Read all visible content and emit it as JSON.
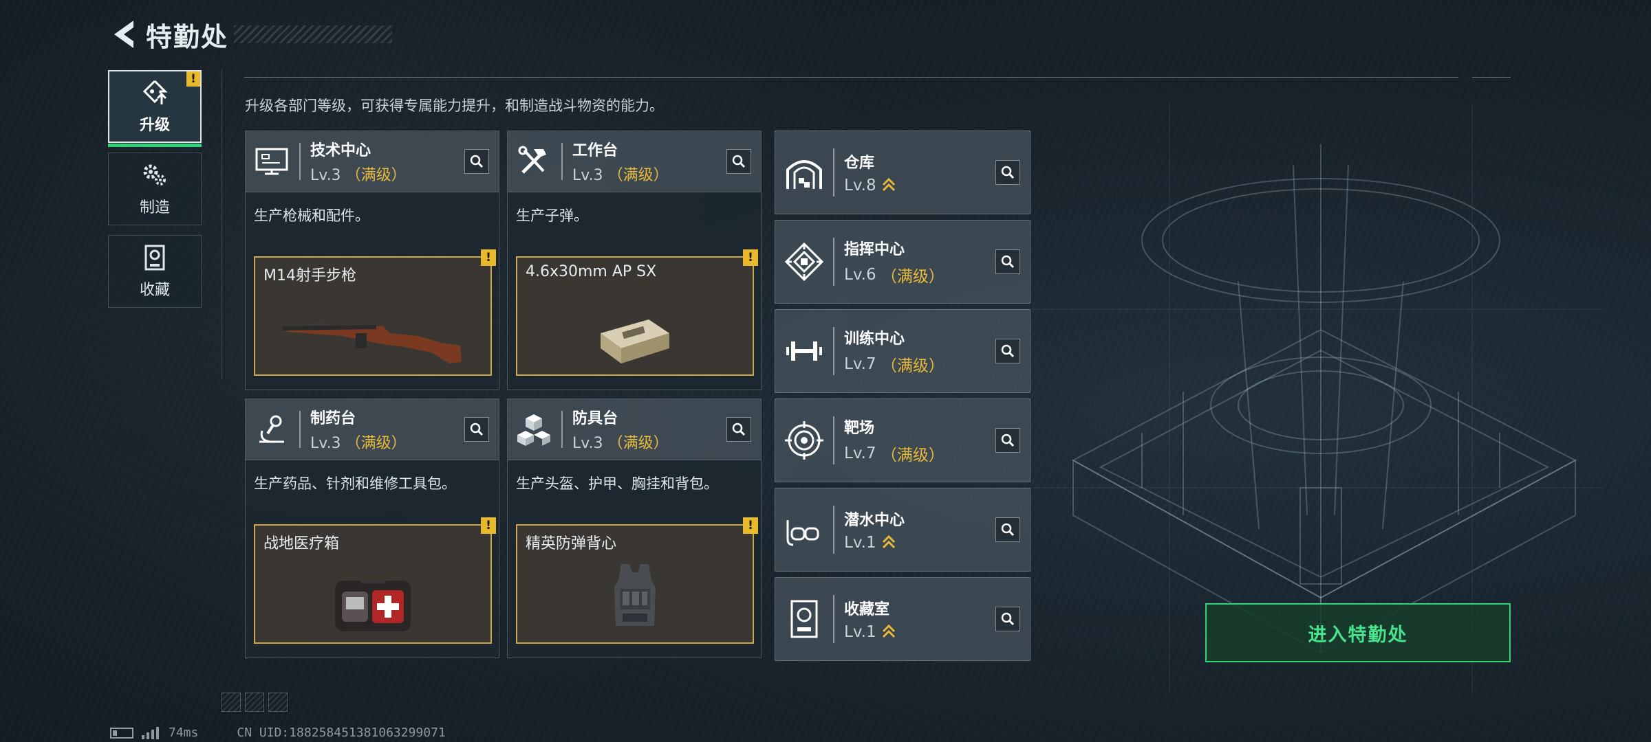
{
  "header": {
    "title": "特勤处"
  },
  "side_nav": [
    {
      "label": "升级",
      "active": true,
      "alert": "!",
      "icon": "upgrade-icon"
    },
    {
      "label": "制造",
      "active": false,
      "icon": "gears-icon"
    },
    {
      "label": "收藏",
      "active": false,
      "icon": "collection-icon"
    }
  ],
  "description": "升级各部门等级，可获得专属能力提升，和制造战斗物资的能力。",
  "stations": [
    {
      "name": "技术中心",
      "level": "Lv.3",
      "max": "（满级）",
      "desc": "生产枪械和配件。",
      "product": "M14射手步枪",
      "alert": "!",
      "icon": "computer-icon"
    },
    {
      "name": "工作台",
      "level": "Lv.3",
      "max": "（满级）",
      "desc": "生产子弹。",
      "product": "4.6x30mm AP SX",
      "alert": "!",
      "icon": "tools-icon"
    },
    {
      "name": "制药台",
      "level": "Lv.3",
      "max": "（满级）",
      "desc": "生产药品、针剂和维修工具包。",
      "product": "战地医疗箱",
      "alert": "!",
      "icon": "microscope-icon"
    },
    {
      "name": "防具台",
      "level": "Lv.3",
      "max": "（满级）",
      "desc": "生产头盔、护甲、胸挂和背包。",
      "product": "精英防弹背心",
      "alert": "!",
      "icon": "armor-blocks-icon"
    }
  ],
  "facilities": [
    {
      "name": "仓库",
      "level": "Lv.8",
      "max": "",
      "upgradable": true,
      "icon": "warehouse-icon"
    },
    {
      "name": "指挥中心",
      "level": "Lv.6",
      "max": "（满级）",
      "upgradable": false,
      "icon": "command-icon"
    },
    {
      "name": "训练中心",
      "level": "Lv.7",
      "max": "（满级）",
      "upgradable": false,
      "icon": "dumbbell-icon"
    },
    {
      "name": "靶场",
      "level": "Lv.7",
      "max": "（满级）",
      "upgradable": false,
      "icon": "target-icon"
    },
    {
      "name": "潜水中心",
      "level": "Lv.1",
      "max": "",
      "upgradable": true,
      "icon": "diving-mask-icon"
    },
    {
      "name": "收藏室",
      "level": "Lv.1",
      "max": "",
      "upgradable": true,
      "icon": "collection-room-icon"
    }
  ],
  "enter_button": "进入特勤处",
  "status": {
    "ping": "74ms",
    "uid": "CN UID:188258451381063299071"
  },
  "colors": {
    "accent_green": "#2fd37a",
    "max_level_gold": "#e9b93a",
    "alert_yellow": "#e7b92b"
  }
}
